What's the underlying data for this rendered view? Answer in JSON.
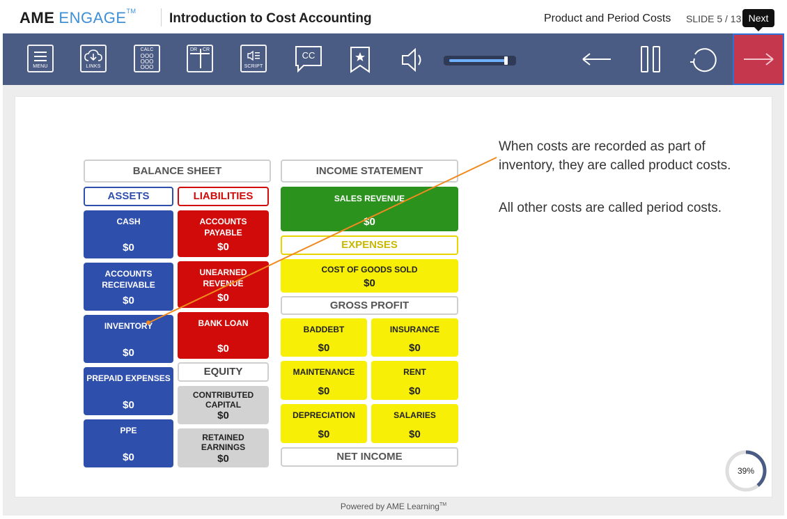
{
  "header": {
    "logo_ame": "AME",
    "logo_engage": "ENGAGE",
    "logo_tm": "TM",
    "course_title": "Introduction to Cost Accounting",
    "section_title": "Product and Period Costs",
    "slide_counter": "SLIDE 5 / 13",
    "tooltip": "Next"
  },
  "toolbar": {
    "menu": "MENU",
    "links": "LINKS",
    "calc": "CALC",
    "calc_digits": "OOO",
    "dr": "DR",
    "cr": "CR",
    "script": "SCRIPT",
    "cc": "CC",
    "volume_level": 0.92,
    "accent_color": "#c4374c"
  },
  "balance_sheet": {
    "title": "BALANCE SHEET",
    "assets_label": "ASSETS",
    "liabilities_label": "LIABILITIES",
    "equity_label": "EQUITY",
    "assets": [
      {
        "label": "CASH",
        "value": "$0"
      },
      {
        "label": "ACCOUNTS RECEIVABLE",
        "value": "$0"
      },
      {
        "label": "INVENTORY",
        "value": "$0"
      },
      {
        "label": "PREPAID EXPENSES",
        "value": "$0"
      },
      {
        "label": "PPE",
        "value": "$0"
      }
    ],
    "liabilities": [
      {
        "label": "ACCOUNTS PAYABLE",
        "value": "$0"
      },
      {
        "label": "UNEARNED REVENUE",
        "value": "$0"
      },
      {
        "label": "BANK LOAN",
        "value": "$0"
      }
    ],
    "equity": [
      {
        "label": "CONTRIBUTED CAPITAL",
        "value": "$0"
      },
      {
        "label": "RETAINED EARNINGS",
        "value": "$0"
      }
    ]
  },
  "income_statement": {
    "title": "INCOME STATEMENT",
    "sales_revenue": {
      "label": "SALES REVENUE",
      "value": "$0"
    },
    "expenses_label": "EXPENSES",
    "cogs": {
      "label": "COST OF GOODS SOLD",
      "value": "$0"
    },
    "gross_profit_label": "GROSS PROFIT",
    "expenses": [
      {
        "label": "BADDEBT",
        "value": "$0"
      },
      {
        "label": "INSURANCE",
        "value": "$0"
      },
      {
        "label": "MAINTENANCE",
        "value": "$0"
      },
      {
        "label": "RENT",
        "value": "$0"
      },
      {
        "label": "DEPRECIATION",
        "value": "$0"
      },
      {
        "label": "SALARIES",
        "value": "$0"
      }
    ],
    "net_income_label": "NET INCOME"
  },
  "notes": {
    "line1": "When costs are recorded as part of",
    "line2": "inventory, they are called product costs.",
    "line3": "All other costs are called period costs."
  },
  "progress": {
    "value": 0.39,
    "label": "39%"
  },
  "footer": {
    "powered": "Powered by AME Learning",
    "tm": "TM"
  }
}
